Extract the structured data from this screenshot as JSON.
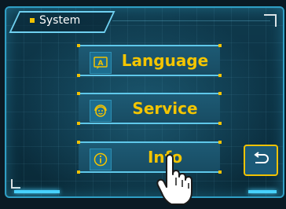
{
  "header": {
    "title": "System"
  },
  "menu": {
    "items": [
      {
        "label": "Language",
        "icon": "language-icon"
      },
      {
        "label": "Service",
        "icon": "service-icon"
      },
      {
        "label": "Info",
        "icon": "info-icon"
      }
    ]
  },
  "controls": {
    "back_icon": "return-arrow-icon"
  },
  "colors": {
    "accent": "#f2c200",
    "frame": "#2f9ec4",
    "background": "#0f3a4d",
    "button": "#1b5a78"
  }
}
